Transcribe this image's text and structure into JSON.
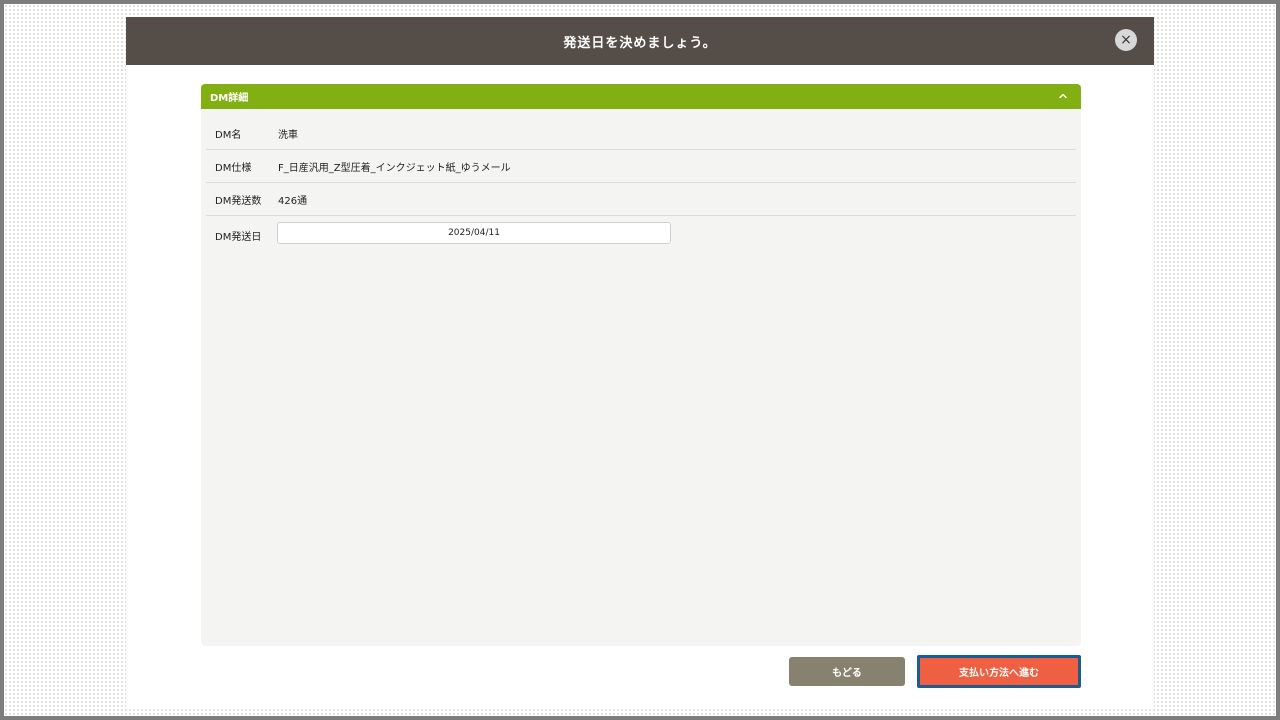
{
  "modal": {
    "title": "発送日を決めましょう。",
    "close_glyph": "×"
  },
  "panel": {
    "title": "DM詳細",
    "collapse_icon": "chevron-up-icon",
    "rows": [
      {
        "label": "DM名",
        "value": "洗車"
      },
      {
        "label": "DM仕様",
        "value": "F_日産汎用_Z型圧着_インクジェット紙_ゆうメール"
      },
      {
        "label": "DM発送数",
        "value": "426通"
      }
    ],
    "date": {
      "label": "DM発送日",
      "value": "2025/04/11"
    }
  },
  "buttons": {
    "back_label": "もどる",
    "next_label": "支払い方法へ進む"
  },
  "colors": {
    "header_bg": "#554d47",
    "panel_header_bg": "#82b012",
    "back_button_bg": "#878270",
    "next_button_bg": "#ef5f42",
    "next_button_focus_border": "#1b5d91"
  }
}
